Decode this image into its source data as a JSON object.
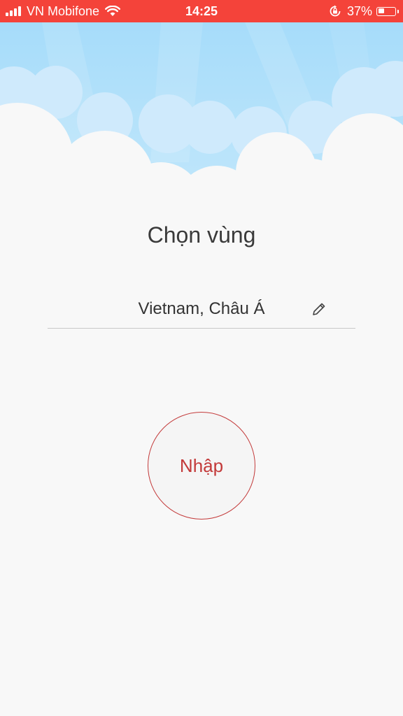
{
  "status_bar": {
    "carrier": "VN Mobifone",
    "time": "14:25",
    "battery_percent_label": "37%",
    "battery_level": 0.37,
    "icons": [
      "signal-icon",
      "wifi-icon",
      "rotation-lock-icon",
      "battery-icon"
    ],
    "background_color": "#f4433a"
  },
  "main": {
    "title": "Chọn vùng",
    "region_value": "Vietnam, Châu Á",
    "submit_label": "Nhập",
    "accent_color": "#c33a3a"
  }
}
